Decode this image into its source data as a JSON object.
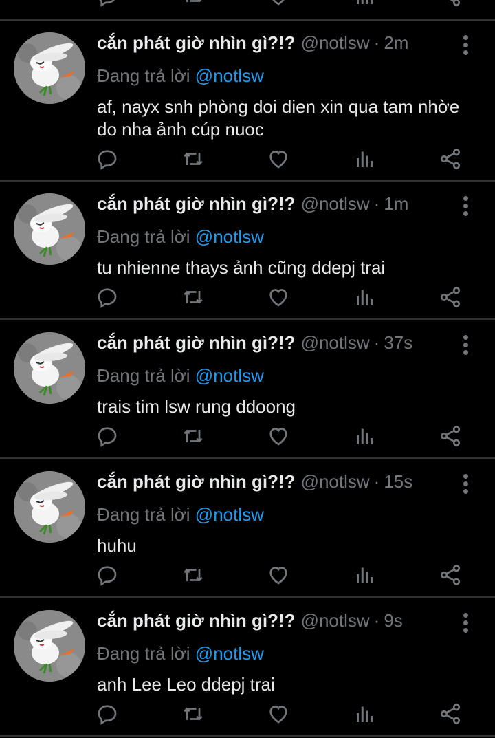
{
  "colors": {
    "background": "#000000",
    "divider": "#2f3336",
    "primary_text": "#e7e9ea",
    "secondary_text": "#71767b",
    "link": "#1d9bf0"
  },
  "action_icons": [
    "reply-icon",
    "retweet-icon",
    "like-icon",
    "views-icon",
    "share-icon"
  ],
  "tweets": [
    {
      "display_name": "cắn phát giờ nhìn gì?!?",
      "handle": "@notlsw",
      "separator": "·",
      "time": "2m",
      "reply_label": "Đang trả lời",
      "reply_to": "@notlsw",
      "text": "af, nayx snh phòng doi dien xin qua tam nhờe do nha ảnh cúp nuoc"
    },
    {
      "display_name": "cắn phát giờ nhìn gì?!?",
      "handle": "@notlsw",
      "separator": "·",
      "time": "1m",
      "reply_label": "Đang trả lời",
      "reply_to": "@notlsw",
      "text": "tu nhienne thays ảnh cũng ddepj trai"
    },
    {
      "display_name": "cắn phát giờ nhìn gì?!?",
      "handle": "@notlsw",
      "separator": "·",
      "time": "37s",
      "reply_label": "Đang trả lời",
      "reply_to": "@notlsw",
      "text": "trais tim lsw rung ddoong"
    },
    {
      "display_name": "cắn phát giờ nhìn gì?!?",
      "handle": "@notlsw",
      "separator": "·",
      "time": "15s",
      "reply_label": "Đang trả lời",
      "reply_to": "@notlsw",
      "text": "huhu"
    },
    {
      "display_name": "cắn phát giờ nhìn gì?!?",
      "handle": "@notlsw",
      "separator": "·",
      "time": "9s",
      "reply_label": "Đang trả lời",
      "reply_to": "@notlsw",
      "text": "anh Lee Leo ddepj trai"
    }
  ]
}
